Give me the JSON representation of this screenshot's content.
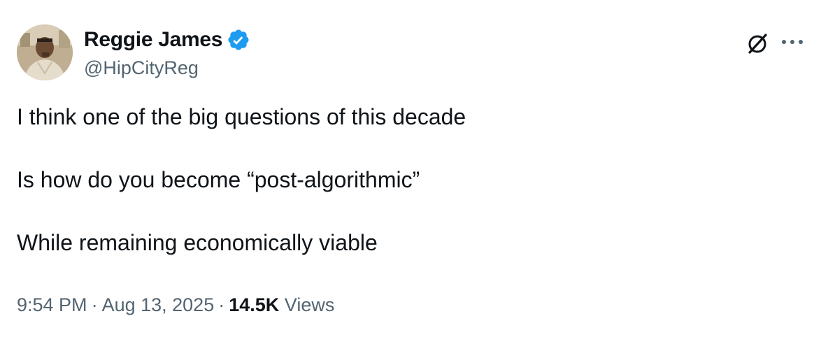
{
  "author": {
    "display_name": "Reggie James",
    "handle": "@HipCityReg",
    "verified": true
  },
  "icons": {
    "verified": "verified-badge-icon",
    "grok": "grok-icon",
    "more": "more-options-icon"
  },
  "colors": {
    "verified_blue": "#1d9bf0",
    "text_primary": "#0f1419",
    "text_secondary": "#536471"
  },
  "tweet": {
    "lines": [
      "I think one of the big questions of this decade",
      "Is how do you become “post-algorithmic”",
      "While remaining economically viable"
    ]
  },
  "meta": {
    "time": "9:54 PM",
    "separator": "·",
    "date": "Aug 13, 2025",
    "views_count": "14.5K",
    "views_label": "Views"
  }
}
